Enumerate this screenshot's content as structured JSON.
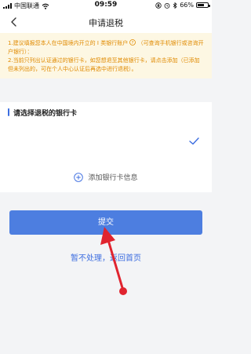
{
  "status_bar": {
    "carrier": "中国联通",
    "time": "09:59",
    "battery_percent": "66%",
    "battery_level": 0.66,
    "icons": [
      "signal-icon",
      "wifi-icon",
      "lock-rotation-icon",
      "alarm-icon",
      "bluetooth-icon",
      "battery-icon"
    ]
  },
  "nav": {
    "title": "申请退税",
    "back_icon": "chevron-left-icon"
  },
  "notice": {
    "line1": "1.建议填报您本人在中国境内开立的 I 类银行账户",
    "line1_suffix": "（可查询手机银行或咨询开户银行）：",
    "line2": "2.当前只列出认证通过的银行卡，如您想退至其他银行卡，请点击添加（已添加但未列出的，可在个人中心认证后再选中进行退税）。",
    "help_icon": "question-circle-icon",
    "color": "#e08a00",
    "background": "#fdf7e3"
  },
  "section": {
    "title": "请选择退税的银行卡"
  },
  "card_list": {
    "selected_icon": "check-icon"
  },
  "add_card": {
    "label": "添加银行卡信息",
    "icon": "plus-circle-icon"
  },
  "actions": {
    "submit_label": "提交",
    "later_label": "暂不处理，返回首页"
  },
  "colors": {
    "accent": "#3c6de0",
    "button": "#4d7ee0",
    "annotation_arrow": "#e0242f"
  }
}
